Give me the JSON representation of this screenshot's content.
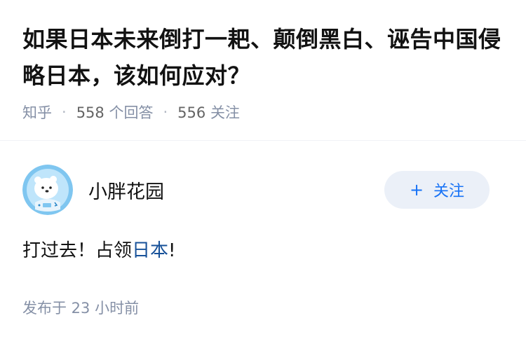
{
  "question": {
    "title": "如果日本未来倒打一耙、颠倒黑白、诬告中国侵略日本，该如何应对？",
    "source": "知乎",
    "answers_count": "558",
    "answers_label": "个回答",
    "followers_count": "556",
    "followers_label": "关注",
    "separator": "·"
  },
  "answer": {
    "author_name": "小胖花园",
    "follow_button": {
      "plus": "+",
      "label": "关注"
    },
    "content": {
      "before": "打过去！占领",
      "link": "日本",
      "after": "!"
    },
    "time": "发布于 23 小时前"
  },
  "colors": {
    "accent": "#1772f6",
    "link": "#175199",
    "meta": "#8590a6",
    "follow_bg": "#ebf0f8"
  },
  "icons": {
    "avatar": "cartoon-bear-astronaut-avatar"
  }
}
